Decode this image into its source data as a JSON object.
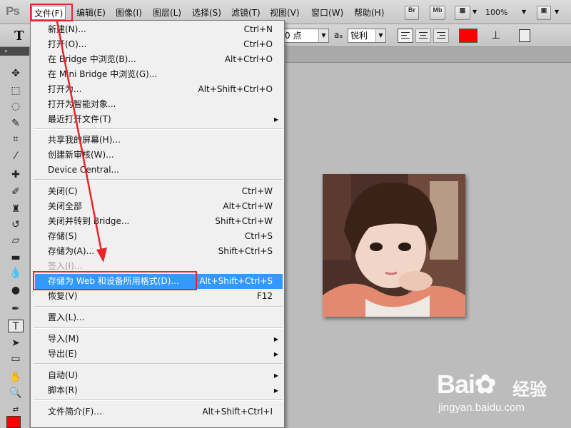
{
  "app": {
    "logo": "Ps"
  },
  "menubar": {
    "items": [
      "文件(F)",
      "编辑(E)",
      "图像(I)",
      "图层(L)",
      "选择(S)",
      "滤镜(T)",
      "视图(V)",
      "窗口(W)",
      "帮助(H)"
    ],
    "bridge_label": "Br",
    "minibridge_label": "Mb",
    "zoom": "100%"
  },
  "options": {
    "font_size": "0 点",
    "aa_label": "a",
    "aa_mode": "锐利",
    "text_color": "#ff0000"
  },
  "file_menu": {
    "items": [
      {
        "label": "新建(N)...",
        "shortcut": "Ctrl+N"
      },
      {
        "label": "打开(O)...",
        "shortcut": "Ctrl+O"
      },
      {
        "label": "在 Bridge 中浏览(B)...",
        "shortcut": "Alt+Ctrl+O"
      },
      {
        "label": "在 Mini Bridge 中浏览(G)...",
        "shortcut": ""
      },
      {
        "label": "打开为...",
        "shortcut": "Alt+Shift+Ctrl+O"
      },
      {
        "label": "打开为智能对象...",
        "shortcut": ""
      },
      {
        "label": "最近打开文件(T)",
        "shortcut": ""
      },
      {
        "label": "共享我的屏幕(H)...",
        "shortcut": ""
      },
      {
        "label": "创建新审核(W)...",
        "shortcut": ""
      },
      {
        "label": "Device Central...",
        "shortcut": ""
      },
      {
        "label": "关闭(C)",
        "shortcut": "Ctrl+W"
      },
      {
        "label": "关闭全部",
        "shortcut": "Alt+Ctrl+W"
      },
      {
        "label": "关闭并转到 Bridge...",
        "shortcut": "Shift+Ctrl+W"
      },
      {
        "label": "存储(S)",
        "shortcut": "Ctrl+S"
      },
      {
        "label": "存储为(A)...",
        "shortcut": "Shift+Ctrl+S"
      },
      {
        "label": "签入(I)...",
        "shortcut": ""
      },
      {
        "label": "存储为 Web 和设备所用格式(D)...",
        "shortcut": "Alt+Shift+Ctrl+S"
      },
      {
        "label": "恢复(V)",
        "shortcut": "F12"
      },
      {
        "label": "置入(L)...",
        "shortcut": ""
      },
      {
        "label": "导入(M)",
        "shortcut": ""
      },
      {
        "label": "导出(E)",
        "shortcut": ""
      },
      {
        "label": "自动(U)",
        "shortcut": ""
      },
      {
        "label": "脚本(R)",
        "shortcut": ""
      },
      {
        "label": "文件简介(F)...",
        "shortcut": "Alt+Shift+Ctrl+I"
      }
    ]
  },
  "watermark": {
    "brand": "Bai",
    "brand2": "经验",
    "url": "jingyan.baidu.com"
  },
  "colors": {
    "accent": "#3399ff",
    "annotation": "#e8262a",
    "foreground": "#ff0000"
  }
}
